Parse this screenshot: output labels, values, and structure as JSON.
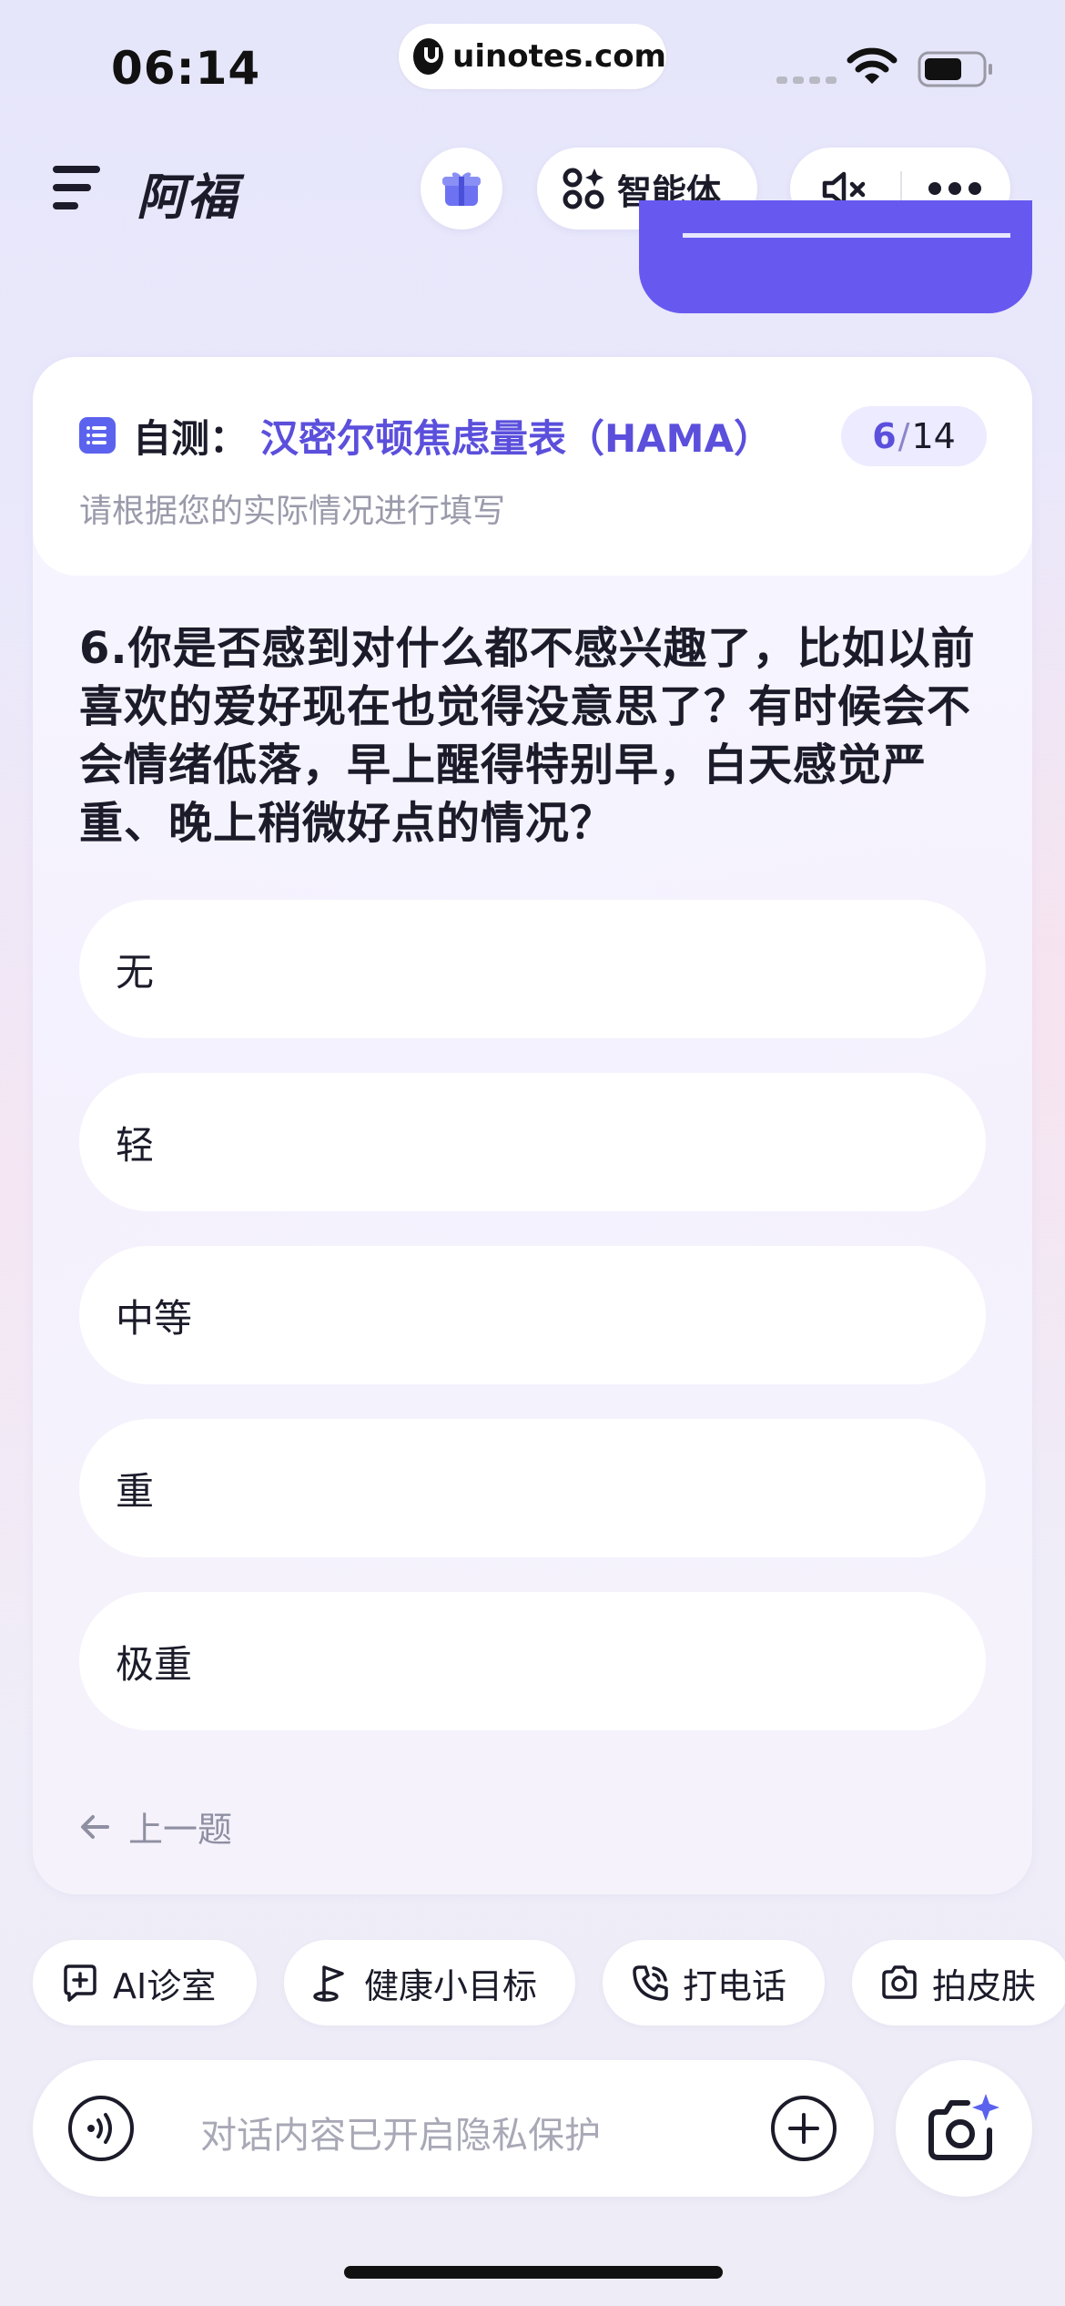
{
  "status_bar": {
    "time": "06:14",
    "url": "uinotes.com"
  },
  "nav": {
    "title": "阿福",
    "agent_label": "智能体"
  },
  "card": {
    "prefix": "自测：",
    "title": "汉密尔顿焦虑量表（HAMA）",
    "progress_current": "6",
    "progress_separator": "/",
    "progress_total": "14",
    "subtitle": "请根据您的实际情况进行填写",
    "question": "6.你是否感到对什么都不感兴趣了，比如以前喜欢的爱好现在也觉得没意思了？有时候会不会情绪低落，早上醒得特别早，白天感觉严重、晚上稍微好点的情况？",
    "options": [
      "无",
      "轻",
      "中等",
      "重",
      "极重"
    ],
    "prev_label": "上一题"
  },
  "chips": [
    "AI诊室",
    "健康小目标",
    "打电话",
    "拍皮肤"
  ],
  "input": {
    "placeholder": "对话内容已开启隐私保护"
  },
  "colors": {
    "accent": "#5b4fdc",
    "bubble": "#6759f0",
    "doc_icon": "#5b62ee"
  }
}
